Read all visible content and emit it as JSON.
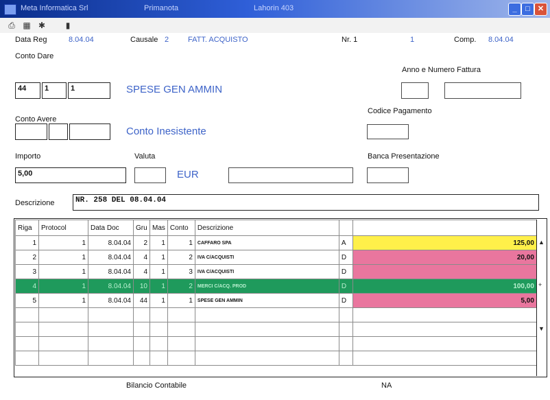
{
  "window": {
    "app": "Meta Informatica Srl",
    "module": "Primanota",
    "company": "Lahorin 403"
  },
  "toolbar": {
    "icons": [
      "printer-tree-icon",
      "grid-icon",
      "settings-icon",
      "book-icon"
    ]
  },
  "header": {
    "data_reg_label": "Data Reg",
    "data_reg_value": "8.04.04",
    "causale_label": "Causale",
    "causale_code": "2",
    "causale_desc": "FATT. ACQUISTO",
    "nr_label": "Nr. 1",
    "nr_value": "1",
    "comp_label": "Comp.",
    "comp_value": "8.04.04"
  },
  "conto_dare": {
    "label": "Conto Dare",
    "f1": "44",
    "f2": "1",
    "f3": "1",
    "desc": "SPESE GEN AMMIN"
  },
  "fattura": {
    "label": "Anno  e  Numero Fattura",
    "anno": "",
    "numero": ""
  },
  "conto_avere": {
    "label": "Conto Avere",
    "f1": "",
    "f2": "",
    "f3": "",
    "desc": "Conto Inesistente"
  },
  "pagamento": {
    "label": "Codice Pagamento",
    "value": ""
  },
  "importo": {
    "label": "Importo",
    "value": "5,00",
    "valuta_label": "Valuta",
    "valuta_value": "",
    "currency": "EUR",
    "extra": ""
  },
  "banca": {
    "label": "Banca Presentazione",
    "value": ""
  },
  "descrizione": {
    "label": "Descrizione",
    "value": "NR. 258      DEL 08.04.04"
  },
  "table": {
    "columns": [
      "Riga",
      "Protocol",
      "Data Doc",
      "Gru",
      "Mas",
      "Conto",
      "Descrizione",
      "",
      ""
    ],
    "rows": [
      {
        "riga": "1",
        "protocol": "1",
        "data": "8.04.04",
        "gru": "2",
        "mas": "1",
        "conto": "1",
        "desc": "CAFFARO SPA",
        "seg": "A",
        "importo": "125,00",
        "color": "yellow"
      },
      {
        "riga": "2",
        "protocol": "1",
        "data": "8.04.04",
        "gru": "4",
        "mas": "1",
        "conto": "2",
        "desc": "IVA C/ACQUISTI",
        "seg": "D",
        "importo": "20,00",
        "color": "pink"
      },
      {
        "riga": "3",
        "protocol": "1",
        "data": "8.04.04",
        "gru": "4",
        "mas": "1",
        "conto": "3",
        "desc": "IVA C/ACQUISTI",
        "seg": "D",
        "importo": "",
        "color": "pink"
      },
      {
        "riga": "4",
        "protocol": "1",
        "data": "8.04.04",
        "gru": "10",
        "mas": "1",
        "conto": "2",
        "desc": "MERCI C/ACQ. PROD",
        "seg": "D",
        "importo": "100,00",
        "color": "pink"
      },
      {
        "riga": "5",
        "protocol": "1",
        "data": "8.04.04",
        "gru": "44",
        "mas": "1",
        "conto": "1",
        "desc": "SPESE GEN AMMIN",
        "seg": "D",
        "importo": "5,00",
        "color": "pink"
      }
    ],
    "selected_row": 3,
    "empty_rows": 4
  },
  "footer": {
    "bilancio_label": "Bilancio Contabile",
    "bilancio_value": "NA"
  },
  "colors": {
    "titlebar": "#0a2d8a",
    "selected_row": "#1f9a5c",
    "yellow": "#fff04a",
    "pink": "#e9769e",
    "label_blue": "#3d63c8"
  }
}
